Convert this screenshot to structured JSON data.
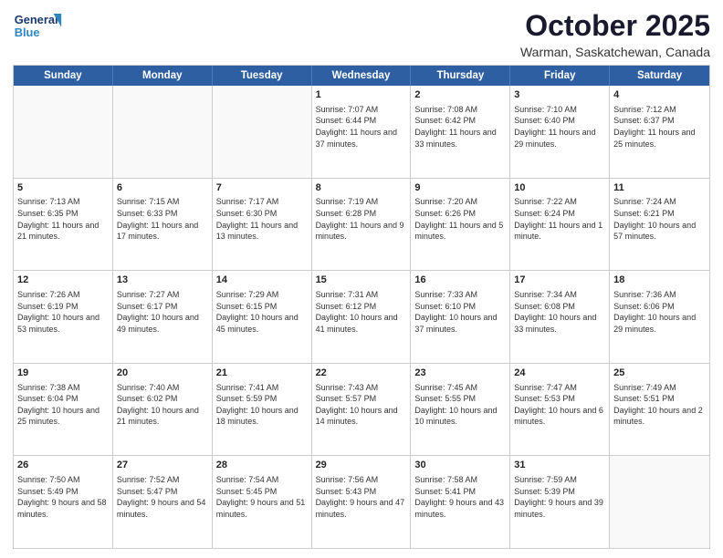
{
  "logo": {
    "line1": "General",
    "line2": "Blue"
  },
  "title": "October 2025",
  "subtitle": "Warman, Saskatchewan, Canada",
  "header_days": [
    "Sunday",
    "Monday",
    "Tuesday",
    "Wednesday",
    "Thursday",
    "Friday",
    "Saturday"
  ],
  "weeks": [
    [
      {
        "day": "",
        "sunrise": "",
        "sunset": "",
        "daylight": ""
      },
      {
        "day": "",
        "sunrise": "",
        "sunset": "",
        "daylight": ""
      },
      {
        "day": "",
        "sunrise": "",
        "sunset": "",
        "daylight": ""
      },
      {
        "day": "1",
        "sunrise": "Sunrise: 7:07 AM",
        "sunset": "Sunset: 6:44 PM",
        "daylight": "Daylight: 11 hours and 37 minutes."
      },
      {
        "day": "2",
        "sunrise": "Sunrise: 7:08 AM",
        "sunset": "Sunset: 6:42 PM",
        "daylight": "Daylight: 11 hours and 33 minutes."
      },
      {
        "day": "3",
        "sunrise": "Sunrise: 7:10 AM",
        "sunset": "Sunset: 6:40 PM",
        "daylight": "Daylight: 11 hours and 29 minutes."
      },
      {
        "day": "4",
        "sunrise": "Sunrise: 7:12 AM",
        "sunset": "Sunset: 6:37 PM",
        "daylight": "Daylight: 11 hours and 25 minutes."
      }
    ],
    [
      {
        "day": "5",
        "sunrise": "Sunrise: 7:13 AM",
        "sunset": "Sunset: 6:35 PM",
        "daylight": "Daylight: 11 hours and 21 minutes."
      },
      {
        "day": "6",
        "sunrise": "Sunrise: 7:15 AM",
        "sunset": "Sunset: 6:33 PM",
        "daylight": "Daylight: 11 hours and 17 minutes."
      },
      {
        "day": "7",
        "sunrise": "Sunrise: 7:17 AM",
        "sunset": "Sunset: 6:30 PM",
        "daylight": "Daylight: 11 hours and 13 minutes."
      },
      {
        "day": "8",
        "sunrise": "Sunrise: 7:19 AM",
        "sunset": "Sunset: 6:28 PM",
        "daylight": "Daylight: 11 hours and 9 minutes."
      },
      {
        "day": "9",
        "sunrise": "Sunrise: 7:20 AM",
        "sunset": "Sunset: 6:26 PM",
        "daylight": "Daylight: 11 hours and 5 minutes."
      },
      {
        "day": "10",
        "sunrise": "Sunrise: 7:22 AM",
        "sunset": "Sunset: 6:24 PM",
        "daylight": "Daylight: 11 hours and 1 minute."
      },
      {
        "day": "11",
        "sunrise": "Sunrise: 7:24 AM",
        "sunset": "Sunset: 6:21 PM",
        "daylight": "Daylight: 10 hours and 57 minutes."
      }
    ],
    [
      {
        "day": "12",
        "sunrise": "Sunrise: 7:26 AM",
        "sunset": "Sunset: 6:19 PM",
        "daylight": "Daylight: 10 hours and 53 minutes."
      },
      {
        "day": "13",
        "sunrise": "Sunrise: 7:27 AM",
        "sunset": "Sunset: 6:17 PM",
        "daylight": "Daylight: 10 hours and 49 minutes."
      },
      {
        "day": "14",
        "sunrise": "Sunrise: 7:29 AM",
        "sunset": "Sunset: 6:15 PM",
        "daylight": "Daylight: 10 hours and 45 minutes."
      },
      {
        "day": "15",
        "sunrise": "Sunrise: 7:31 AM",
        "sunset": "Sunset: 6:12 PM",
        "daylight": "Daylight: 10 hours and 41 minutes."
      },
      {
        "day": "16",
        "sunrise": "Sunrise: 7:33 AM",
        "sunset": "Sunset: 6:10 PM",
        "daylight": "Daylight: 10 hours and 37 minutes."
      },
      {
        "day": "17",
        "sunrise": "Sunrise: 7:34 AM",
        "sunset": "Sunset: 6:08 PM",
        "daylight": "Daylight: 10 hours and 33 minutes."
      },
      {
        "day": "18",
        "sunrise": "Sunrise: 7:36 AM",
        "sunset": "Sunset: 6:06 PM",
        "daylight": "Daylight: 10 hours and 29 minutes."
      }
    ],
    [
      {
        "day": "19",
        "sunrise": "Sunrise: 7:38 AM",
        "sunset": "Sunset: 6:04 PM",
        "daylight": "Daylight: 10 hours and 25 minutes."
      },
      {
        "day": "20",
        "sunrise": "Sunrise: 7:40 AM",
        "sunset": "Sunset: 6:02 PM",
        "daylight": "Daylight: 10 hours and 21 minutes."
      },
      {
        "day": "21",
        "sunrise": "Sunrise: 7:41 AM",
        "sunset": "Sunset: 5:59 PM",
        "daylight": "Daylight: 10 hours and 18 minutes."
      },
      {
        "day": "22",
        "sunrise": "Sunrise: 7:43 AM",
        "sunset": "Sunset: 5:57 PM",
        "daylight": "Daylight: 10 hours and 14 minutes."
      },
      {
        "day": "23",
        "sunrise": "Sunrise: 7:45 AM",
        "sunset": "Sunset: 5:55 PM",
        "daylight": "Daylight: 10 hours and 10 minutes."
      },
      {
        "day": "24",
        "sunrise": "Sunrise: 7:47 AM",
        "sunset": "Sunset: 5:53 PM",
        "daylight": "Daylight: 10 hours and 6 minutes."
      },
      {
        "day": "25",
        "sunrise": "Sunrise: 7:49 AM",
        "sunset": "Sunset: 5:51 PM",
        "daylight": "Daylight: 10 hours and 2 minutes."
      }
    ],
    [
      {
        "day": "26",
        "sunrise": "Sunrise: 7:50 AM",
        "sunset": "Sunset: 5:49 PM",
        "daylight": "Daylight: 9 hours and 58 minutes."
      },
      {
        "day": "27",
        "sunrise": "Sunrise: 7:52 AM",
        "sunset": "Sunset: 5:47 PM",
        "daylight": "Daylight: 9 hours and 54 minutes."
      },
      {
        "day": "28",
        "sunrise": "Sunrise: 7:54 AM",
        "sunset": "Sunset: 5:45 PM",
        "daylight": "Daylight: 9 hours and 51 minutes."
      },
      {
        "day": "29",
        "sunrise": "Sunrise: 7:56 AM",
        "sunset": "Sunset: 5:43 PM",
        "daylight": "Daylight: 9 hours and 47 minutes."
      },
      {
        "day": "30",
        "sunrise": "Sunrise: 7:58 AM",
        "sunset": "Sunset: 5:41 PM",
        "daylight": "Daylight: 9 hours and 43 minutes."
      },
      {
        "day": "31",
        "sunrise": "Sunrise: 7:59 AM",
        "sunset": "Sunset: 5:39 PM",
        "daylight": "Daylight: 9 hours and 39 minutes."
      },
      {
        "day": "",
        "sunrise": "",
        "sunset": "",
        "daylight": ""
      }
    ]
  ]
}
